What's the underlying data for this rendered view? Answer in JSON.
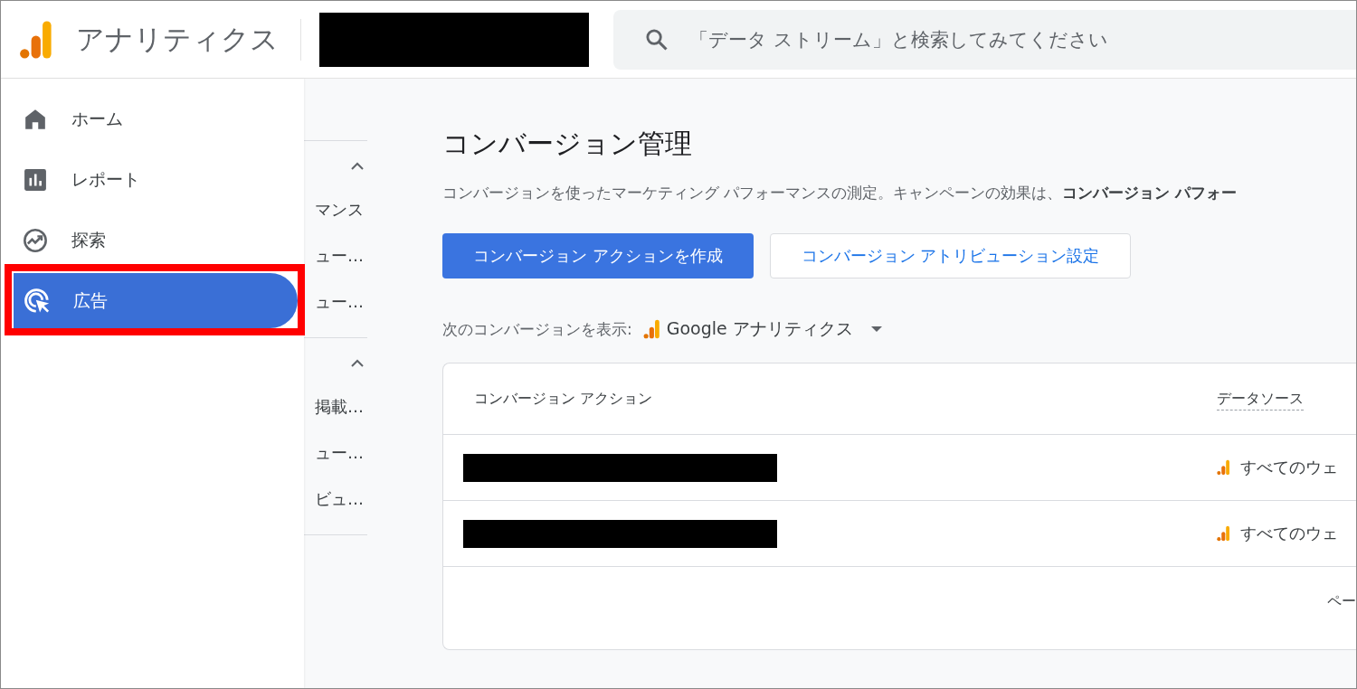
{
  "header": {
    "product": "アナリティクス",
    "search": {
      "placeholder": "「データ ストリーム」と検索してみてください"
    }
  },
  "drawer": {
    "items": [
      {
        "label": "ホーム",
        "selected": false,
        "highlighted": false
      },
      {
        "label": "レポート",
        "selected": false,
        "highlighted": false
      },
      {
        "label": "探索",
        "selected": false,
        "highlighted": false
      },
      {
        "label": "広告",
        "selected": true,
        "highlighted": true
      }
    ]
  },
  "subnav": {
    "sections": [
      {
        "expanded": true,
        "items": [
          "マンス",
          "ュー…",
          "ュー…"
        ]
      },
      {
        "expanded": true,
        "items": [
          "掲載…",
          "ュー…",
          "ビュ…"
        ]
      }
    ]
  },
  "page": {
    "title": "コンバージョン管理",
    "description": "コンバージョンを使ったマーケティング パフォーマンスの測定。キャンペーンの効果は、**コンバージョン パフォー**",
    "buttons": [
      {
        "label": "コンバージョン アクションを作成",
        "kind": "primary"
      },
      {
        "label": "コンバージョン アトリビューション設定",
        "kind": "secondary"
      }
    ],
    "source_filter": {
      "label": "次のコンバージョンを表示:",
      "value": "Google アナリティクス"
    },
    "table": {
      "columns": [
        "コンバージョン アクション",
        "データソース"
      ],
      "rows": [
        {
          "data_source": "すべてのウェ"
        },
        {
          "data_source": "すべてのウェ"
        }
      ],
      "pagination": "ペー"
    }
  }
}
